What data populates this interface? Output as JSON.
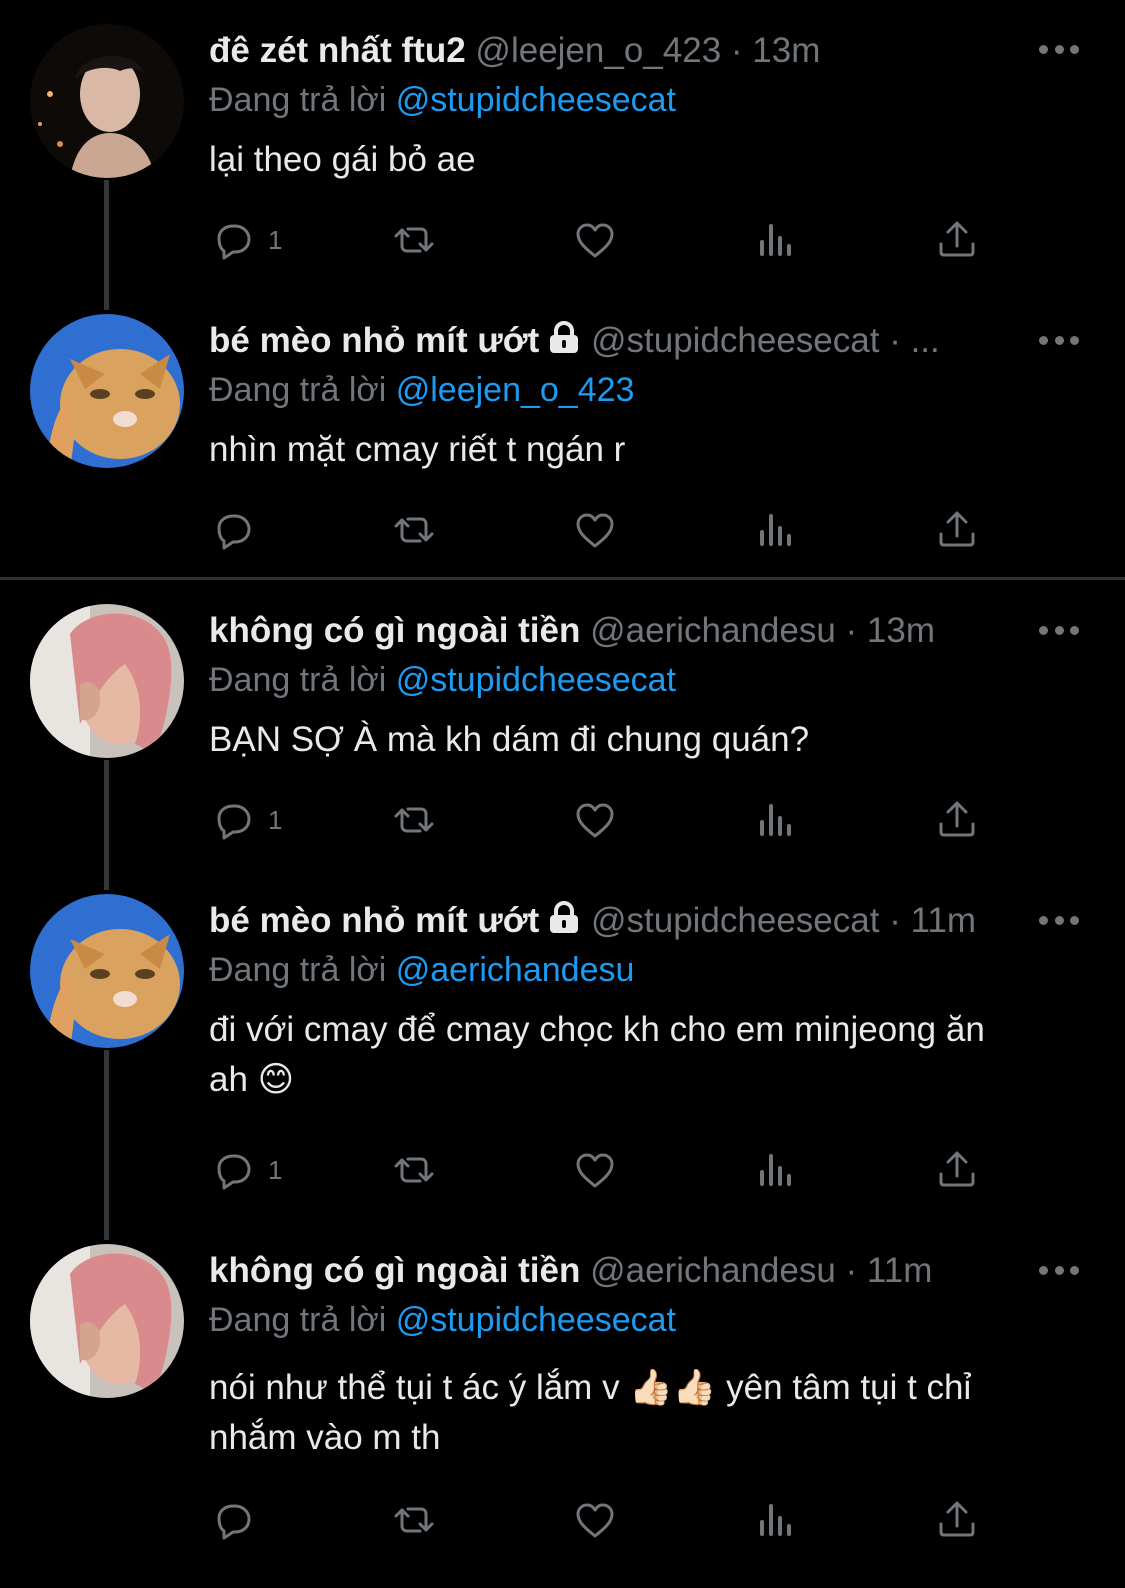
{
  "theme": {
    "background": "#000000",
    "text": "#e7e9ea",
    "muted": "#71767b",
    "link": "#1d9bf0"
  },
  "icons": {
    "reply": "reply-icon",
    "retweet": "retweet-icon",
    "like": "heart-icon",
    "views": "views-icon",
    "share": "share-icon",
    "more": "more-icon",
    "lock": "lock-icon"
  },
  "tweets": [
    {
      "name": "đê zét nhất ftu2",
      "handle": "@leejen_o_423",
      "time": "· 13m",
      "reply_prefix": "Đang trả lời",
      "reply_to": "@stupidcheesecat",
      "text": "lại theo gái bỏ ae",
      "reply_count": "1"
    },
    {
      "name": "bé mèo nhỏ mít ướt",
      "handle": "@stupidcheesecat",
      "time": "· ...",
      "reply_prefix": "Đang trả lời",
      "reply_to": "@leejen_o_423",
      "text": "nhìn mặt cmay riết t ngán r",
      "reply_count": ""
    },
    {
      "name": "không có gì ngoài tiền",
      "handle": "@aerichandesu",
      "time": "· 13m",
      "reply_prefix": "Đang trả lời",
      "reply_to": "@stupidcheesecat",
      "text": "BẠN SỢ À mà kh dám đi chung quán?",
      "reply_count": "1"
    },
    {
      "name": "bé mèo nhỏ mít ướt",
      "handle": "@stupidcheesecat",
      "time": "· 11m",
      "reply_prefix": "Đang trả lời",
      "reply_to": "@aerichandesu",
      "text_line1": "đi với cmay để cmay chọc kh cho em minjeong ăn",
      "text_line2": "ah 😊",
      "reply_count": "1"
    },
    {
      "name": "không có gì ngoài tiền",
      "handle": "@aerichandesu",
      "time": "· 11m",
      "reply_prefix": "Đang trả lời",
      "reply_to": "@stupidcheesecat",
      "text_line1": "nói như thể tụi t ác ý lắm v 👍🏻👍🏻  yên tâm tụi t chỉ",
      "text_line2": "nhắm vào m th",
      "reply_count": ""
    }
  ]
}
